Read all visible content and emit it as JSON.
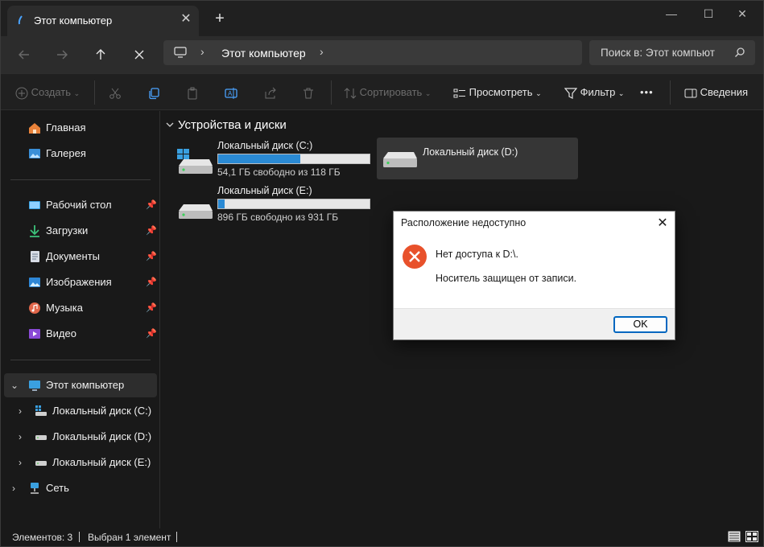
{
  "tab": {
    "title": "Этот компьютер",
    "close": "✕",
    "new_tab": "+"
  },
  "window_controls": {
    "minimize": "—",
    "maximize": "☐",
    "close": "✕"
  },
  "address": {
    "location": "Этот компьютер",
    "separator": "›"
  },
  "search": {
    "placeholder": "Поиск в: Этот компьют"
  },
  "commands": {
    "create": "Создать",
    "sort": "Сортировать",
    "view": "Просмотреть",
    "filter": "Фильтр",
    "more": "•••",
    "details": "Сведения"
  },
  "sidebar": {
    "quick": [
      {
        "label": "Главная",
        "icon": "home-icon"
      },
      {
        "label": "Галерея",
        "icon": "gallery-icon"
      }
    ],
    "pinned": [
      {
        "label": "Рабочий стол",
        "icon": "desktop-icon"
      },
      {
        "label": "Загрузки",
        "icon": "downloads-icon"
      },
      {
        "label": "Документы",
        "icon": "documents-icon"
      },
      {
        "label": "Изображения",
        "icon": "pictures-icon"
      },
      {
        "label": "Музыка",
        "icon": "music-icon"
      },
      {
        "label": "Видео",
        "icon": "videos-icon"
      }
    ],
    "tree": [
      {
        "label": "Этот компьютер",
        "icon": "this-pc-icon"
      },
      {
        "label": "Локальный диск (C:)",
        "icon": "drive-windows-icon"
      },
      {
        "label": "Локальный диск (D:)",
        "icon": "drive-icon"
      },
      {
        "label": "Локальный диск (E:)",
        "icon": "drive-icon"
      },
      {
        "label": "Сеть",
        "icon": "network-icon"
      }
    ]
  },
  "content": {
    "group_title": "Устройства и диски",
    "drives": [
      {
        "name": "Локальный диск (C:)",
        "free": "54,1 ГБ свободно из 118 ГБ",
        "used_fraction": 0.54
      },
      {
        "name": "Локальный диск (D:)",
        "free": "",
        "used_fraction": null
      },
      {
        "name": "Локальный диск (E:)",
        "free": "896 ГБ свободно из 931 ГБ",
        "used_fraction": 0.04
      }
    ]
  },
  "status": {
    "count": "Элементов: 3",
    "selected": "Выбран 1 элемент"
  },
  "dialog": {
    "title": "Расположение недоступно",
    "message": "Нет доступа к D:\\.",
    "detail": "Носитель защищен от записи.",
    "ok": "OK",
    "close": "✕"
  },
  "colors": {
    "accent": "#2a8ad4",
    "error": "#e8512b",
    "dialog_border": "#0067c0"
  }
}
